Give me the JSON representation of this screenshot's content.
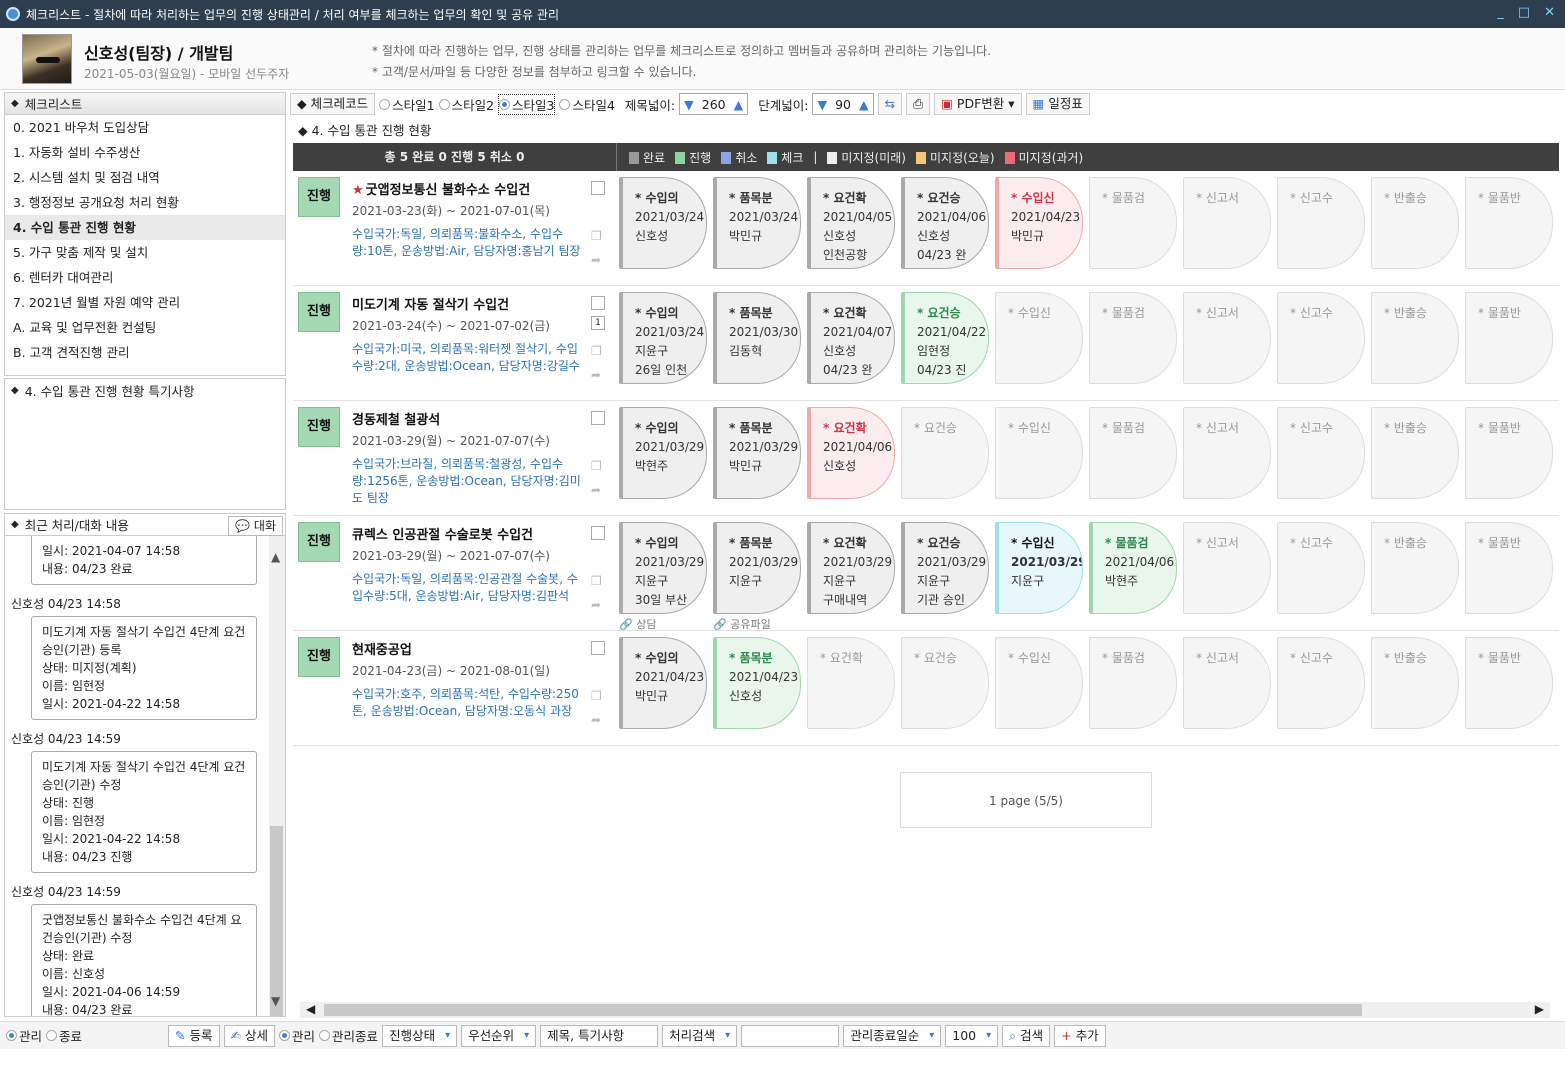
{
  "window": {
    "title": "체크리스트 - 절차에 따라 처리하는 업무의 진행 상태관리 / 처리 여부를 체크하는 업무의 확인 및 공유 관리",
    "controls": [
      "_",
      "□",
      "✕"
    ]
  },
  "user": {
    "name": "신호성(팀장) / 개발팀",
    "date": "2021-05-03(월요일) - 모바일 선두주자"
  },
  "notes": [
    "* 절차에 따라 진행하는 업무, 진행 상태를 관리하는 업무를 체크리스트로 정의하고 멤버들과 공유하며 관리하는 기능입니다.",
    "* 고객/문서/파일 등 다양한 정보를 첨부하고 링크할 수 있습니다."
  ],
  "checklist": {
    "title": "체크리스트",
    "items": [
      "0. 2021 바우처 도입상담",
      "1. 자동화 설비 수주생산",
      "2. 시스템 설치 및 점검 내역",
      "3. 행정정보 공개요청 처리 현황",
      "4. 수입 통관 진행 현황",
      "5. 가구 맞춤 제작 및 설치",
      "6. 렌터카 대여관리",
      "7. 2021년 월별 자원 예약 관리",
      "A. 교육 및 업무전환 컨설팅",
      "B. 고객 견적진행 관리"
    ]
  },
  "special": {
    "title": "4. 수입 통관 진행 현황 특기사항"
  },
  "recent": {
    "title": "최근 처리/대화 내용",
    "chat_label": "대화",
    "entries": [
      {
        "name": "",
        "lines": [
          "일시: 2021-04-07 14:58",
          "내용: 04/23 완료"
        ]
      },
      {
        "name": "신호성   04/23 14:58",
        "lines": [
          "미도기계 자동 절삭기 수입건 4단계 요건승인(기관) 등록",
          "상태: 미지정(계획)",
          "이름: 임현정",
          "일시: 2021-04-22 14:58"
        ]
      },
      {
        "name": "신호성   04/23 14:59",
        "lines": [
          "미도기계 자동 절삭기 수입건 4단계 요건승인(기관) 수정",
          "상태: 진행",
          "이름: 임현정",
          "일시: 2021-04-22 14:58",
          "내용: 04/23 진행"
        ]
      },
      {
        "name": "신호성   04/23 14:59",
        "lines": [
          "굿앱정보통신 불화수소 수입건 4단계 요건승인(기관) 수정",
          "상태: 완료",
          "이름: 신호성",
          "일시: 2021-04-06 14:59",
          "내용: 04/23 완료"
        ]
      }
    ]
  },
  "toolbar": {
    "checkcode": "체크레코드",
    "styles": [
      "스타일1",
      "스타일2",
      "스타일3",
      "스타일4"
    ],
    "title_width_label": "제목넓이:",
    "title_width": "260",
    "step_width_label": "단계넓이:",
    "step_width": "90",
    "pdf": "PDF변환",
    "schedule": "일정표"
  },
  "section_title": "4. 수입 통관 진행 현황",
  "summary": "총 5  완료 0  진행 5  취소 0",
  "legend": [
    {
      "label": "완료",
      "color": "#999999"
    },
    {
      "label": "진행",
      "color": "#8fd3a3"
    },
    {
      "label": "취소",
      "color": "#8fa3e0"
    },
    {
      "label": "체크",
      "color": "#9fe0ea"
    },
    {
      "label": "미지정(미래)",
      "color": "#eeeeee"
    },
    {
      "label": "미지정(오늘)",
      "color": "#f5c77a"
    },
    {
      "label": "미지정(과거)",
      "color": "#ec6a7a"
    }
  ],
  "legend_sep": "|",
  "rows": [
    {
      "status": "진행",
      "star": true,
      "title": "굿앱정보통신 불화수소 수입건",
      "dates": "2021-03-23(화) ~ 2021-07-01(목)",
      "desc": "수입국가:독일, 의뢰품목:불화수소, 수입수량:10톤, 운송방법:Air, 담당자명:홍남기 팀장",
      "steps": [
        {
          "name": "* 수입의",
          "state": "done",
          "lines": [
            "2021/03/24",
            "신호성"
          ]
        },
        {
          "name": "* 품목분",
          "state": "done",
          "lines": [
            "2021/03/24",
            "박민규"
          ]
        },
        {
          "name": "* 요건확",
          "state": "done",
          "lines": [
            "2021/04/05",
            "신호성",
            "인천공항"
          ]
        },
        {
          "name": "* 요건승",
          "state": "done",
          "lines": [
            "2021/04/06",
            "신호성",
            "04/23 완"
          ]
        },
        {
          "name": "* 수입신",
          "state": "past",
          "lines": [
            "2021/04/23",
            "박민규"
          ]
        },
        {
          "name": "* 물품검",
          "state": "none",
          "lines": []
        },
        {
          "name": "* 신고서",
          "state": "none",
          "lines": []
        },
        {
          "name": "* 신고수",
          "state": "none",
          "lines": []
        },
        {
          "name": "* 반출승",
          "state": "none",
          "lines": []
        },
        {
          "name": "* 물품반",
          "state": "none",
          "lines": []
        }
      ]
    },
    {
      "status": "진행",
      "star": false,
      "title": "미도기계 자동 절삭기 수입건",
      "dates": "2021-03-24(수) ~ 2021-07-02(금)",
      "desc": "수입국가:미국, 의뢰품목:워터젯 절삭기, 수입수량:2대, 운송방법:Ocean, 담당자명:강길수",
      "badge_count": "1",
      "steps": [
        {
          "name": "* 수입의",
          "state": "done",
          "lines": [
            "2021/03/24",
            "지윤구",
            "26일 인천"
          ]
        },
        {
          "name": "* 품목분",
          "state": "done",
          "lines": [
            "2021/03/30",
            "김동혁"
          ]
        },
        {
          "name": "* 요건확",
          "state": "done",
          "lines": [
            "2021/04/07",
            "신호성",
            "04/23 완"
          ]
        },
        {
          "name": "* 요건승",
          "state": "prog",
          "lines": [
            "2021/04/22",
            "임현정",
            "04/23 진"
          ]
        },
        {
          "name": "* 수입신",
          "state": "none",
          "lines": []
        },
        {
          "name": "* 물품검",
          "state": "none",
          "lines": []
        },
        {
          "name": "* 신고서",
          "state": "none",
          "lines": []
        },
        {
          "name": "* 신고수",
          "state": "none",
          "lines": []
        },
        {
          "name": "* 반출승",
          "state": "none",
          "lines": []
        },
        {
          "name": "* 물품반",
          "state": "none",
          "lines": []
        }
      ]
    },
    {
      "status": "진행",
      "star": false,
      "title": "경동제철 철광석",
      "dates": "2021-03-29(월) ~ 2021-07-07(수)",
      "desc": "수입국가:브라질, 의뢰품목:철광성, 수입수량:1256톤, 운송방법:Ocean, 담당자명:김미도 팀장",
      "steps": [
        {
          "name": "* 수입의",
          "state": "done",
          "lines": [
            "2021/03/29",
            "박현주"
          ]
        },
        {
          "name": "* 품목분",
          "state": "done",
          "lines": [
            "2021/03/29",
            "박민규"
          ]
        },
        {
          "name": "* 요건확",
          "state": "past",
          "lines": [
            "2021/04/06",
            "신호성"
          ]
        },
        {
          "name": "* 요건승",
          "state": "none",
          "lines": []
        },
        {
          "name": "* 수입신",
          "state": "none",
          "lines": []
        },
        {
          "name": "* 물품검",
          "state": "none",
          "lines": []
        },
        {
          "name": "* 신고서",
          "state": "none",
          "lines": []
        },
        {
          "name": "* 신고수",
          "state": "none",
          "lines": []
        },
        {
          "name": "* 반출승",
          "state": "none",
          "lines": []
        },
        {
          "name": "* 물품반",
          "state": "none",
          "lines": []
        }
      ]
    },
    {
      "status": "진행",
      "star": false,
      "title": "큐렉스 인공관절 수술로봇 수입건",
      "dates": "2021-03-29(월) ~ 2021-07-07(수)",
      "desc": "수입국가:독일, 의뢰품목:인공관절 수술봇, 수입수량:5대, 운송방법:Air, 담당자명:김판석",
      "links": [
        "상담",
        "공유파일"
      ],
      "steps": [
        {
          "name": "* 수입의",
          "state": "done",
          "lines": [
            "2021/03/29",
            "지윤구",
            "30일 부산"
          ]
        },
        {
          "name": "* 품목분",
          "state": "done",
          "lines": [
            "2021/03/29",
            "지윤구"
          ]
        },
        {
          "name": "* 요건확",
          "state": "done",
          "lines": [
            "2021/03/29",
            "지윤구",
            "구매내역"
          ]
        },
        {
          "name": "* 요건승",
          "state": "done",
          "lines": [
            "2021/03/29",
            "지윤구",
            "기관 승인"
          ]
        },
        {
          "name": "* 수입신",
          "state": "check",
          "lines": [
            "2021/03/29",
            "지윤구"
          ]
        },
        {
          "name": "* 물품검",
          "state": "prog",
          "lines": [
            "2021/04/06",
            "박현주"
          ]
        },
        {
          "name": "* 신고서",
          "state": "none",
          "lines": []
        },
        {
          "name": "* 신고수",
          "state": "none",
          "lines": []
        },
        {
          "name": "* 반출승",
          "state": "none",
          "lines": []
        },
        {
          "name": "* 물품반",
          "state": "none",
          "lines": []
        }
      ]
    },
    {
      "status": "진행",
      "star": false,
      "title": "현재중공업",
      "dates": "2021-04-23(금) ~ 2021-08-01(일)",
      "desc": "수입국가:호주, 의뢰품목:석탄, 수입수량:250톤, 운송방법:Ocean, 담당자명:오동식 과장",
      "steps": [
        {
          "name": "* 수입의",
          "state": "done",
          "lines": [
            "2021/04/23",
            "박민규"
          ]
        },
        {
          "name": "* 품목분",
          "state": "prog",
          "lines": [
            "2021/04/23",
            "신호성"
          ]
        },
        {
          "name": "* 요건확",
          "state": "none",
          "lines": []
        },
        {
          "name": "* 요건승",
          "state": "none",
          "lines": []
        },
        {
          "name": "* 수입신",
          "state": "none",
          "lines": []
        },
        {
          "name": "* 물품검",
          "state": "none",
          "lines": []
        },
        {
          "name": "* 신고서",
          "state": "none",
          "lines": []
        },
        {
          "name": "* 신고수",
          "state": "none",
          "lines": []
        },
        {
          "name": "* 반출승",
          "state": "none",
          "lines": []
        },
        {
          "name": "* 물품반",
          "state": "none",
          "lines": []
        }
      ]
    }
  ],
  "pager": "1 page (5/5)",
  "bottom_left": {
    "manage": "관리",
    "end": "종료",
    "register": "등록",
    "detail": "상세"
  },
  "bottom": {
    "manage": "관리",
    "manage_end": "관리종료",
    "status": "진행상태",
    "priority": "우선순위",
    "field": "제목, 특기사항",
    "proc_search": "처리검색",
    "sort": "관리종료일순",
    "count": "100",
    "search": "검색",
    "add": "추가"
  }
}
